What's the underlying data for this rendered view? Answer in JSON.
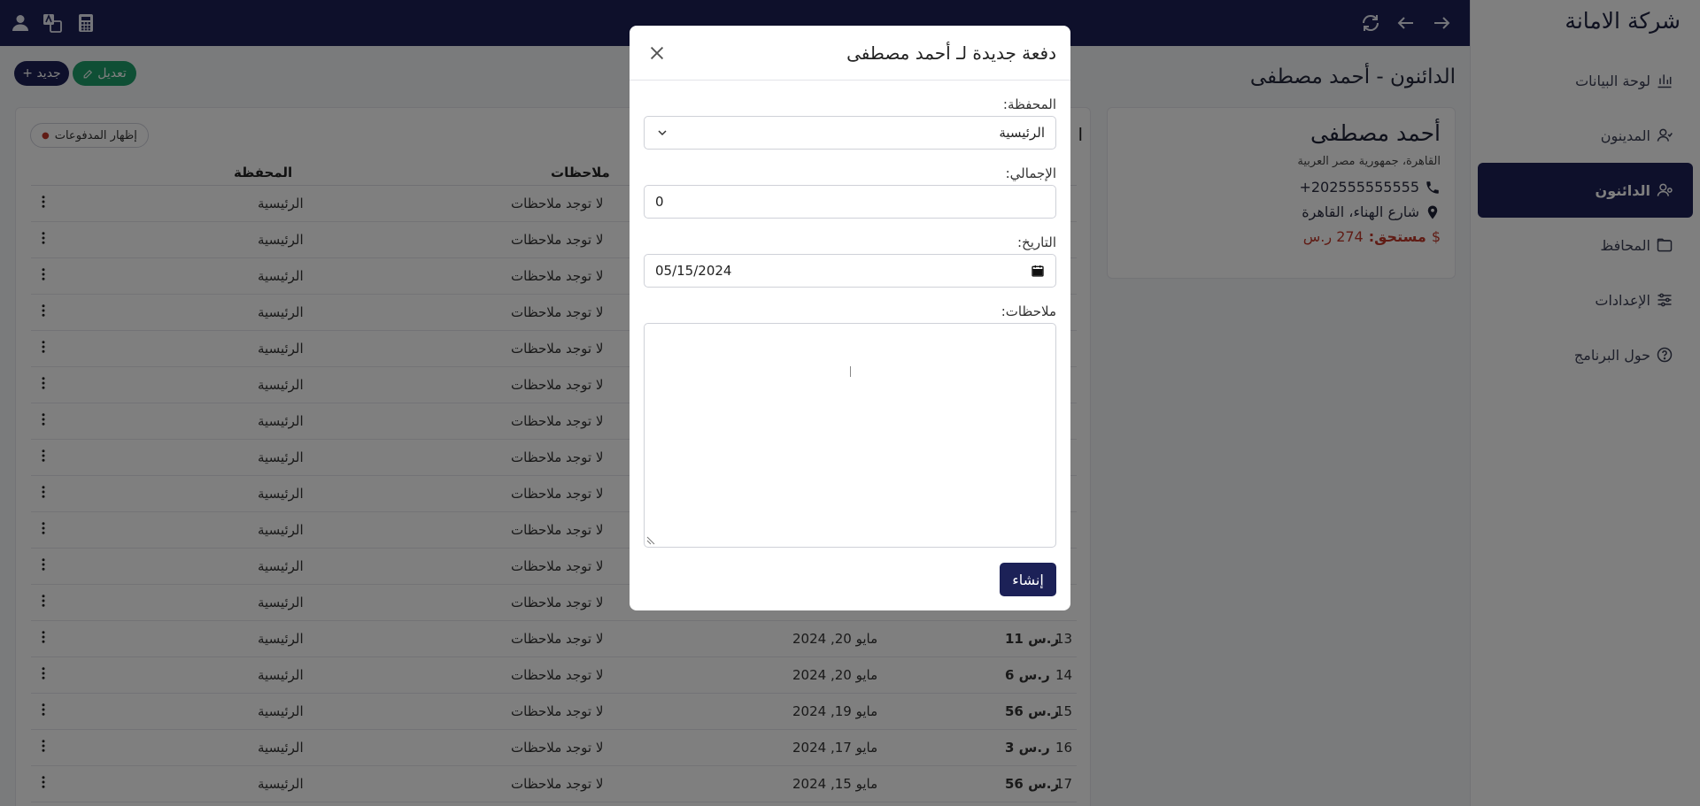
{
  "app": {
    "brand": "شركة الامانة"
  },
  "sidebar": {
    "items": [
      {
        "label": "لوحة البيانات",
        "icon": "chart-bar-icon",
        "active": false
      },
      {
        "label": "المدينون",
        "icon": "user-icon",
        "active": false
      },
      {
        "label": "الدائنون",
        "icon": "user-icon",
        "active": true
      },
      {
        "label": "المحافظ",
        "icon": "folder-icon",
        "active": false
      },
      {
        "label": "الإعدادات",
        "icon": "sliders-icon",
        "active": false
      },
      {
        "label": "حول البرنامج",
        "icon": "help-circle-icon",
        "active": false
      }
    ]
  },
  "topbar": {
    "icons": [
      "user-icon",
      "translate-icon",
      "calculator-icon",
      "refresh-icon",
      "arrow-left-icon",
      "arrow-right-icon"
    ]
  },
  "page": {
    "title": "الدائنون - أحمد مصطفى",
    "new_button": "جديد +",
    "edit_button": "تعديل"
  },
  "profile": {
    "name": "أحمد مصطفى",
    "address": "القاهرة، جمهورية مصر العربية",
    "phone": "+202555555555",
    "street": "شارع الهناء، القاهرة",
    "due_label": "مستحق:",
    "due_value": "274 ر.س",
    "due_symbol": "$"
  },
  "table": {
    "show_payments": "إظهار المدفوعات",
    "headers": {
      "wallet": "المحفظة",
      "notes": "ملاحظات"
    },
    "partial_title": "ا",
    "rows": [
      {
        "num": "",
        "amount": "",
        "date": "",
        "notes": "لا توجد ملاحظات",
        "wallet": "الرئيسية"
      },
      {
        "num": "",
        "amount": "",
        "date": "",
        "notes": "لا توجد ملاحظات",
        "wallet": "الرئيسية"
      },
      {
        "num": "",
        "amount": "",
        "date": "",
        "notes": "لا توجد ملاحظات",
        "wallet": "الرئيسية"
      },
      {
        "num": "",
        "amount": "",
        "date": "",
        "notes": "لا توجد ملاحظات",
        "wallet": "الرئيسية"
      },
      {
        "num": "",
        "amount": "",
        "date": "",
        "notes": "لا توجد ملاحظات",
        "wallet": "الرئيسية"
      },
      {
        "num": "",
        "amount": "",
        "date": "",
        "notes": "لا توجد ملاحظات",
        "wallet": "الرئيسية"
      },
      {
        "num": "",
        "amount": "",
        "date": "",
        "notes": "لا توجد ملاحظات",
        "wallet": "الرئيسية"
      },
      {
        "num": "",
        "amount": "",
        "date": "",
        "notes": "لا توجد ملاحظات",
        "wallet": "الرئيسية"
      },
      {
        "num": "",
        "amount": "",
        "date": "",
        "notes": "لا توجد ملاحظات",
        "wallet": "الرئيسية"
      },
      {
        "num": "",
        "amount": "",
        "date": "",
        "notes": "لا توجد ملاحظات",
        "wallet": "الرئيسية"
      },
      {
        "num": "",
        "amount": "",
        "date": "",
        "notes": "لا توجد ملاحظات",
        "wallet": "الرئيسية"
      },
      {
        "num": "",
        "amount": "",
        "date": "",
        "notes": "لا توجد ملاحظات",
        "wallet": "الرئيسية"
      },
      {
        "num": "13",
        "amount": "11 ر.س",
        "date": "مايو 20, 2024",
        "notes": "لا توجد ملاحظات",
        "wallet": "الرئيسية"
      },
      {
        "num": "14",
        "amount": "6 ر.س",
        "date": "مايو 20, 2024",
        "notes": "لا توجد ملاحظات",
        "wallet": "الرئيسية"
      },
      {
        "num": "15",
        "amount": "56 ر.س",
        "date": "مايو 19, 2024",
        "notes": "لا توجد ملاحظات",
        "wallet": "الرئيسية"
      },
      {
        "num": "16",
        "amount": "3 ر.س",
        "date": "مايو 17, 2024",
        "notes": "لا توجد ملاحظات",
        "wallet": "الرئيسية"
      },
      {
        "num": "17",
        "amount": "56 ر.س",
        "date": "مايو 15, 2024",
        "notes": "لا توجد ملاحظات",
        "wallet": "الرئيسية"
      }
    ]
  },
  "modal": {
    "title": "دفعة جديدة لـ أحمد مصطفى",
    "wallet_label": "المحفظة:",
    "wallet_value": "الرئيسية",
    "total_label": "الإجمالي:",
    "total_value": "0",
    "date_label": "التاريخ:",
    "date_value": "05/15/2024",
    "notes_label": "ملاحظات:",
    "notes_value": "",
    "create_button": "إنشاء"
  }
}
